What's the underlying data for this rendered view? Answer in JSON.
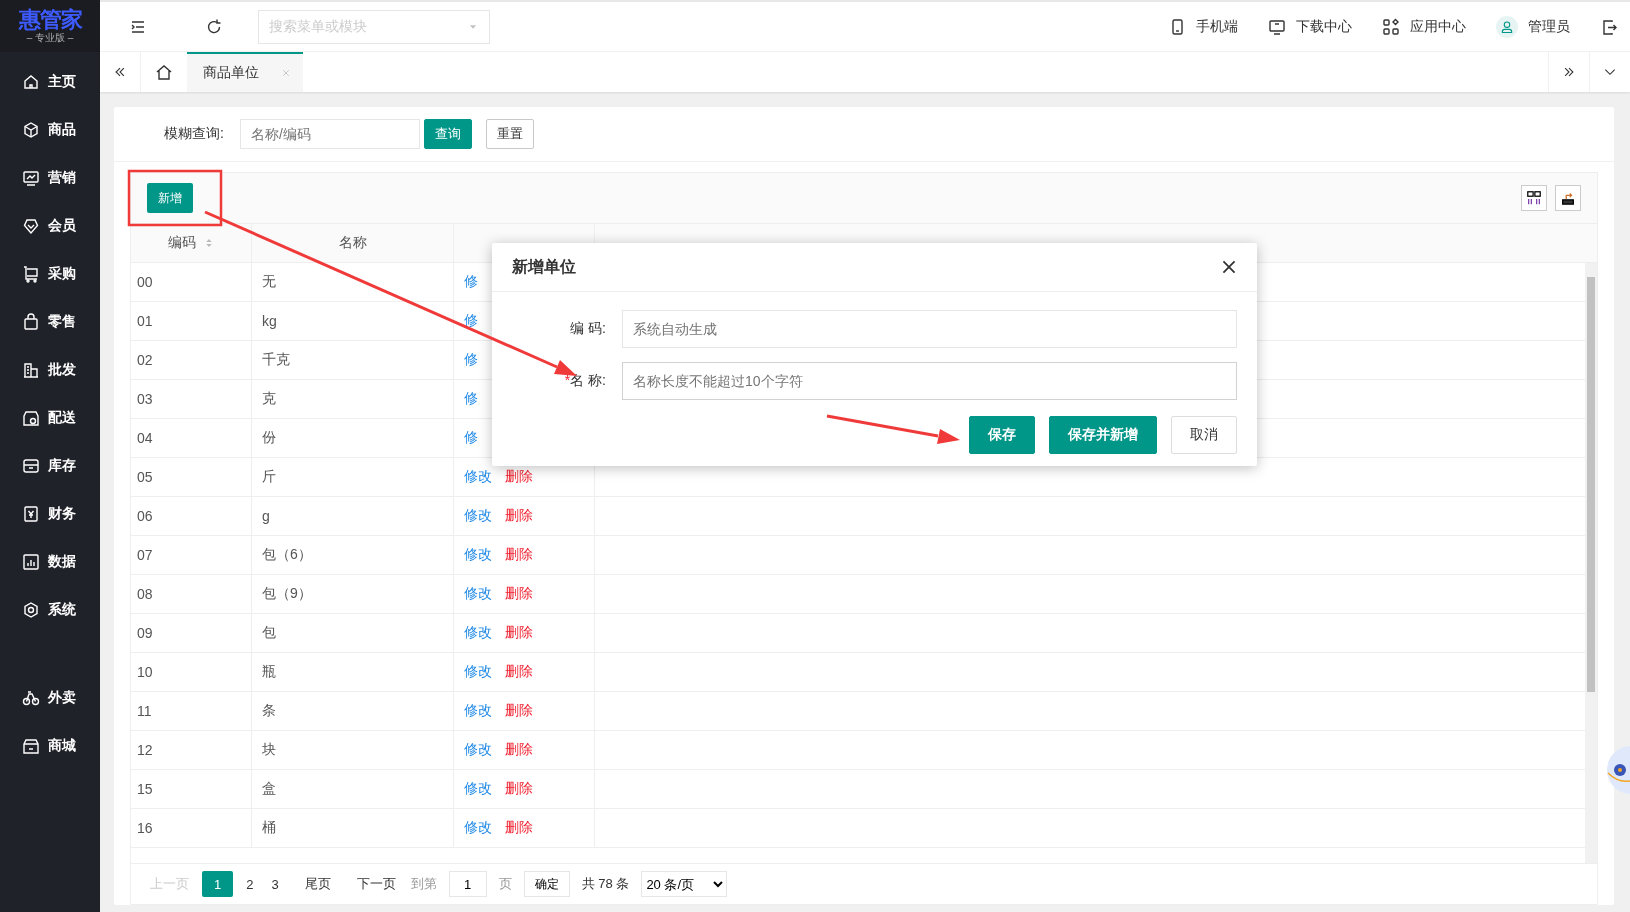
{
  "sidebar": {
    "logo": "惠管家",
    "edition": "– 专业版 –",
    "items": [
      {
        "label": "主页",
        "selected": false
      },
      {
        "label": "商品",
        "selected": false
      },
      {
        "label": "营销",
        "selected": false
      },
      {
        "label": "会员",
        "selected": false
      },
      {
        "label": "采购",
        "selected": false
      },
      {
        "label": "零售",
        "selected": false
      },
      {
        "label": "批发",
        "selected": false
      },
      {
        "label": "配送",
        "selected": false
      },
      {
        "label": "库存",
        "selected": false
      },
      {
        "label": "财务",
        "selected": false
      },
      {
        "label": "数据",
        "selected": false
      },
      {
        "label": "系统",
        "selected": false
      }
    ],
    "extra_items": [
      {
        "label": "外卖",
        "selected": false
      },
      {
        "label": "商城",
        "selected": false
      }
    ]
  },
  "topbar": {
    "search": {
      "placeholder": "搜索菜单或模块"
    },
    "links": [
      "手机端",
      "下载中心",
      "应用中心"
    ],
    "user": "管理员"
  },
  "tabs": [
    {
      "label": "商品单位",
      "selected": true
    }
  ],
  "filter": {
    "label": "模糊查询:",
    "placeholder": "名称/编码",
    "buttons": [
      "查询",
      "重置"
    ]
  },
  "toolbar": {
    "add_button": "新增"
  },
  "table": {
    "columns": [
      {
        "label": "编码",
        "sortable": true
      },
      {
        "label": "名称",
        "sortable": false
      },
      {
        "sortable": false
      }
    ],
    "rows": [
      {
        "code": "00",
        "name": "无",
        "actions": [
          "修"
        ]
      },
      {
        "code": "01",
        "name": "kg",
        "actions": [
          "修"
        ]
      },
      {
        "code": "02",
        "name": "千克",
        "actions": [
          "修"
        ]
      },
      {
        "code": "03",
        "name": "克",
        "actions": [
          "修"
        ]
      },
      {
        "code": "04",
        "name": "份",
        "actions": [
          "修"
        ]
      },
      {
        "code": "05",
        "name": "斤",
        "actions": [
          "修改",
          "删除"
        ]
      },
      {
        "code": "06",
        "name": "g",
        "actions": [
          "修改",
          "删除"
        ]
      },
      {
        "code": "07",
        "name": "包（6）",
        "actions": [
          "修改",
          "删除"
        ]
      },
      {
        "code": "08",
        "name": "包（9）",
        "actions": [
          "修改",
          "删除"
        ]
      },
      {
        "code": "09",
        "name": "包",
        "actions": [
          "修改",
          "删除"
        ]
      },
      {
        "code": "10",
        "name": "瓶",
        "actions": [
          "修改",
          "删除"
        ]
      },
      {
        "code": "11",
        "name": "条",
        "actions": [
          "修改",
          "删除"
        ]
      },
      {
        "code": "12",
        "name": "块",
        "actions": [
          "修改",
          "删除"
        ]
      },
      {
        "code": "15",
        "name": "盒",
        "actions": [
          "修改",
          "删除"
        ]
      },
      {
        "code": "16",
        "name": "桶",
        "actions": [
          "修改",
          "删除"
        ]
      }
    ]
  },
  "pagination": {
    "prev": {
      "label": "上一页",
      "disabled": true
    },
    "pages": [
      {
        "label": "1",
        "selected": true
      },
      {
        "label": "2",
        "selected": false
      },
      {
        "label": "3",
        "selected": false
      }
    ],
    "last": "尾页",
    "next": "下一页",
    "goto_label": "到第",
    "goto_value": "1",
    "page_unit": "页",
    "confirm": "确定",
    "total": "共 78 条",
    "page_size": "20 条/页"
  },
  "dialog": {
    "title": "新增单位",
    "fields": [
      {
        "label": "编 码:",
        "placeholder": "系统自动生成"
      },
      {
        "label": "名 称:",
        "required_mark": "*",
        "placeholder": "名称长度不能超过10个字符"
      }
    ],
    "buttons": [
      {
        "label": "保存",
        "kind": "primary"
      },
      {
        "label": "保存并新增",
        "kind": "primary"
      },
      {
        "label": "取消",
        "kind": "default"
      }
    ]
  }
}
